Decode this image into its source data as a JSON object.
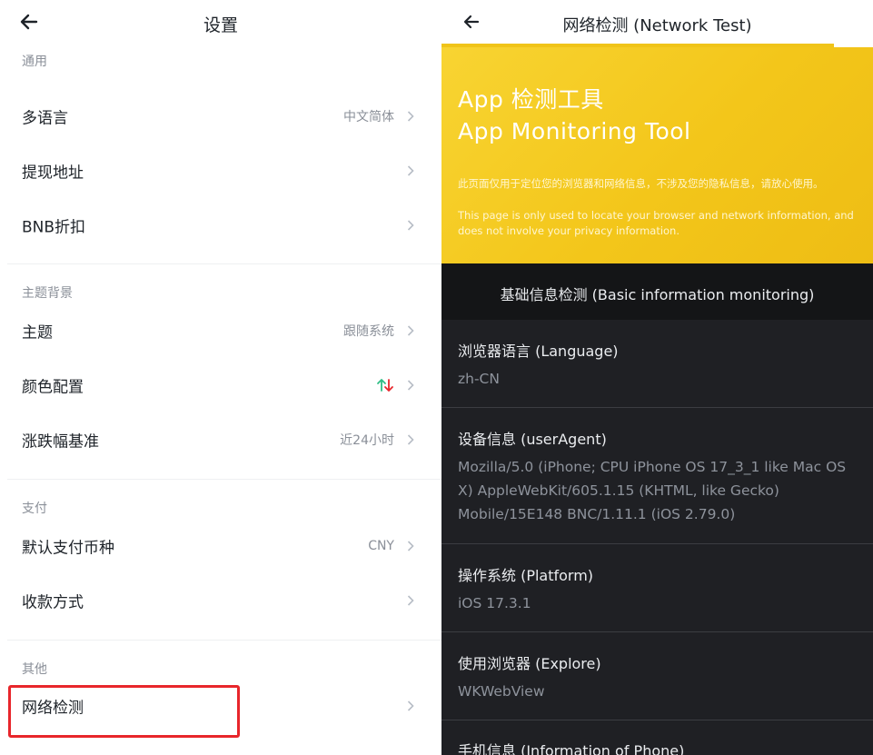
{
  "left": {
    "header": {
      "title": "设置"
    },
    "sections": [
      {
        "label": "通用",
        "items": [
          {
            "label": "多语言",
            "value": "中文简体"
          },
          {
            "label": "提现地址",
            "value": ""
          },
          {
            "label": "BNB折扣",
            "value": ""
          }
        ]
      },
      {
        "label": "主题背景",
        "items": [
          {
            "label": "主题",
            "value": "跟随系统"
          },
          {
            "label": "颜色配置",
            "value": ""
          },
          {
            "label": "涨跌幅基准",
            "value": "近24小时"
          }
        ]
      },
      {
        "label": "支付",
        "items": [
          {
            "label": "默认支付币种",
            "value": "CNY"
          },
          {
            "label": "收款方式",
            "value": ""
          }
        ]
      },
      {
        "label": "其他",
        "items": [
          {
            "label": "网络检测",
            "value": ""
          }
        ]
      }
    ],
    "colors": {
      "up": "#2ebd85",
      "down": "#e8262b",
      "highlight": "#e8262b"
    }
  },
  "right": {
    "header": {
      "title": "网络检测 (Network Test)"
    },
    "hero": {
      "title_cn": "App 检测工具",
      "title_en": "App Monitoring Tool",
      "desc_cn": "此页面仅用于定位您的浏览器和网络信息，不涉及您的隐私信息，请放心使用。",
      "desc_en": "This page is only used to locate your browser and network information, and does not involve your privacy information.",
      "color": "#f3c61a"
    },
    "section_title": "基础信息检测 (Basic information monitoring)",
    "info": [
      {
        "label": "浏览器语言 (Language)",
        "value": "zh-CN"
      },
      {
        "label": "设备信息 (userAgent)",
        "value": "Mozilla/5.0 (iPhone; CPU iPhone OS 17_3_1 like Mac OS X) AppleWebKit/605.1.15 (KHTML, like Gecko) Mobile/15E148 BNC/1.11.1 (iOS 2.79.0)"
      },
      {
        "label": "操作系统 (Platform)",
        "value": "iOS 17.3.1"
      },
      {
        "label": "使用浏览器 (Explore)",
        "value": "WKWebView"
      },
      {
        "label": "手机信息 (Information of Phone)",
        "value": ""
      }
    ]
  }
}
